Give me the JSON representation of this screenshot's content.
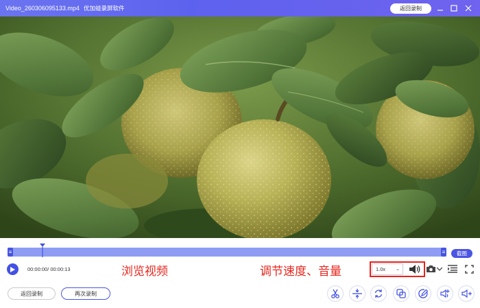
{
  "window": {
    "title": "Video_260306095133.mp4",
    "app_name": "优加蛙录屏软件",
    "back_button": "返回录制",
    "accent": "#5d62ee"
  },
  "player": {
    "time_text": "00:00:00/ 00:00:13",
    "screenshot_label": "截图",
    "speed_value": "1.0x",
    "progress_fraction": 0.07
  },
  "annotations": {
    "browse": "浏览视频",
    "adjust": "调节速度、音量",
    "color": "#e8261d"
  },
  "footer": {
    "back_record": "返回录制",
    "record_again": "再次录制"
  },
  "tools": [
    "scissors-icon",
    "merge-icon",
    "rotate-icon",
    "crop-icon",
    "edit-icon",
    "volume-add-icon",
    "volume-split-icon"
  ]
}
